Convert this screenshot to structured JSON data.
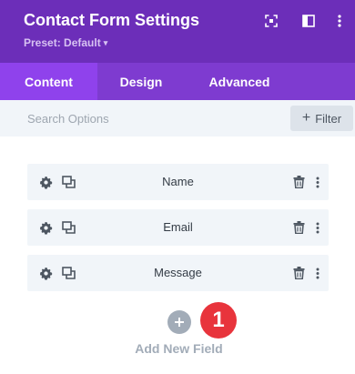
{
  "header": {
    "title": "Contact Form Settings",
    "preset": "Preset: Default",
    "icons": [
      "focus-mode-icon",
      "split-view-icon",
      "more-menu-icon"
    ]
  },
  "tabs": [
    {
      "label": "Content",
      "active": true
    },
    {
      "label": "Design",
      "active": false
    },
    {
      "label": "Advanced",
      "active": false
    }
  ],
  "search": {
    "placeholder": "Search Options",
    "value": "",
    "filter_label": "Filter"
  },
  "fields": [
    {
      "label": "Name"
    },
    {
      "label": "Email"
    },
    {
      "label": "Message"
    }
  ],
  "add_field": {
    "label": "Add New Field",
    "badge": "1"
  },
  "colors": {
    "header_bg": "#6c2eb9",
    "tabs_bg": "#7e3bd0",
    "active_tab": "#8f42ec",
    "badge": "#e8343c",
    "muted": "#a2acb8"
  }
}
